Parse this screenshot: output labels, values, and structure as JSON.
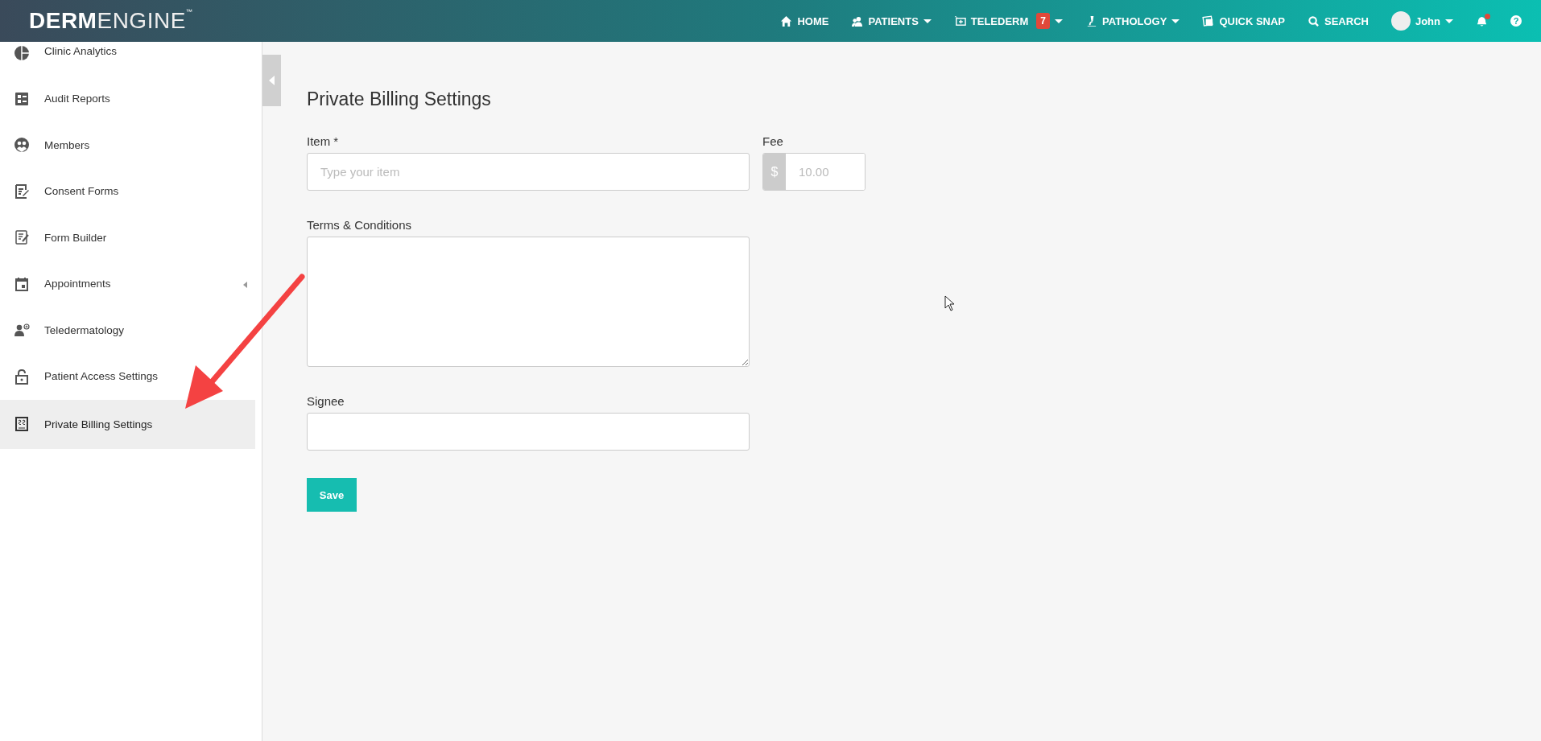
{
  "logo": {
    "bold": "DERM",
    "light": "ENGINE",
    "mark": "™"
  },
  "nav": [
    {
      "kind": "home",
      "label": "HOME",
      "dropdown": false
    },
    {
      "kind": "patients",
      "label": "PATIENTS",
      "dropdown": true
    },
    {
      "kind": "telederm",
      "label": "TELEDERM",
      "badge": "7",
      "dropdown": true
    },
    {
      "kind": "pathology",
      "label": "PATHOLOGY",
      "dropdown": true
    },
    {
      "kind": "snap",
      "label": "QUICK SNAP",
      "dropdown": false
    },
    {
      "kind": "search",
      "label": "SEARCH",
      "dropdown": false
    },
    {
      "kind": "user",
      "label": "John",
      "dropdown": true
    },
    {
      "kind": "bell",
      "dropdown": false,
      "notification": true
    },
    {
      "kind": "help",
      "glyph": "?",
      "dropdown": false
    }
  ],
  "sidebar": {
    "items": [
      {
        "kind": "analytics",
        "label": "Clinic Analytics",
        "selected": false,
        "submenu": false
      },
      {
        "kind": "audit",
        "label": "Audit Reports",
        "selected": false,
        "submenu": false
      },
      {
        "kind": "members",
        "label": "Members",
        "selected": false,
        "submenu": false
      },
      {
        "kind": "consent",
        "label": "Consent Forms",
        "selected": false,
        "submenu": false
      },
      {
        "kind": "form",
        "label": "Form Builder",
        "selected": false,
        "submenu": false
      },
      {
        "kind": "calendar",
        "label": "Appointments",
        "selected": false,
        "submenu": true
      },
      {
        "kind": "telederm",
        "label": "Teledermatology",
        "selected": false,
        "submenu": false
      },
      {
        "kind": "lock",
        "label": "Patient Access Settings",
        "selected": false,
        "submenu": false
      },
      {
        "kind": "billing",
        "label": "Private Billing Settings",
        "selected": true,
        "submenu": false
      }
    ]
  },
  "page": {
    "title": "Private Billing Settings",
    "item": {
      "label": "Item *",
      "placeholder": "Type your item"
    },
    "fee": {
      "label": "Fee",
      "prefix": "$",
      "placeholder": "10.00"
    },
    "terms": {
      "label": "Terms & Conditions"
    },
    "signee": {
      "label": "Signee"
    },
    "save": "Save"
  }
}
